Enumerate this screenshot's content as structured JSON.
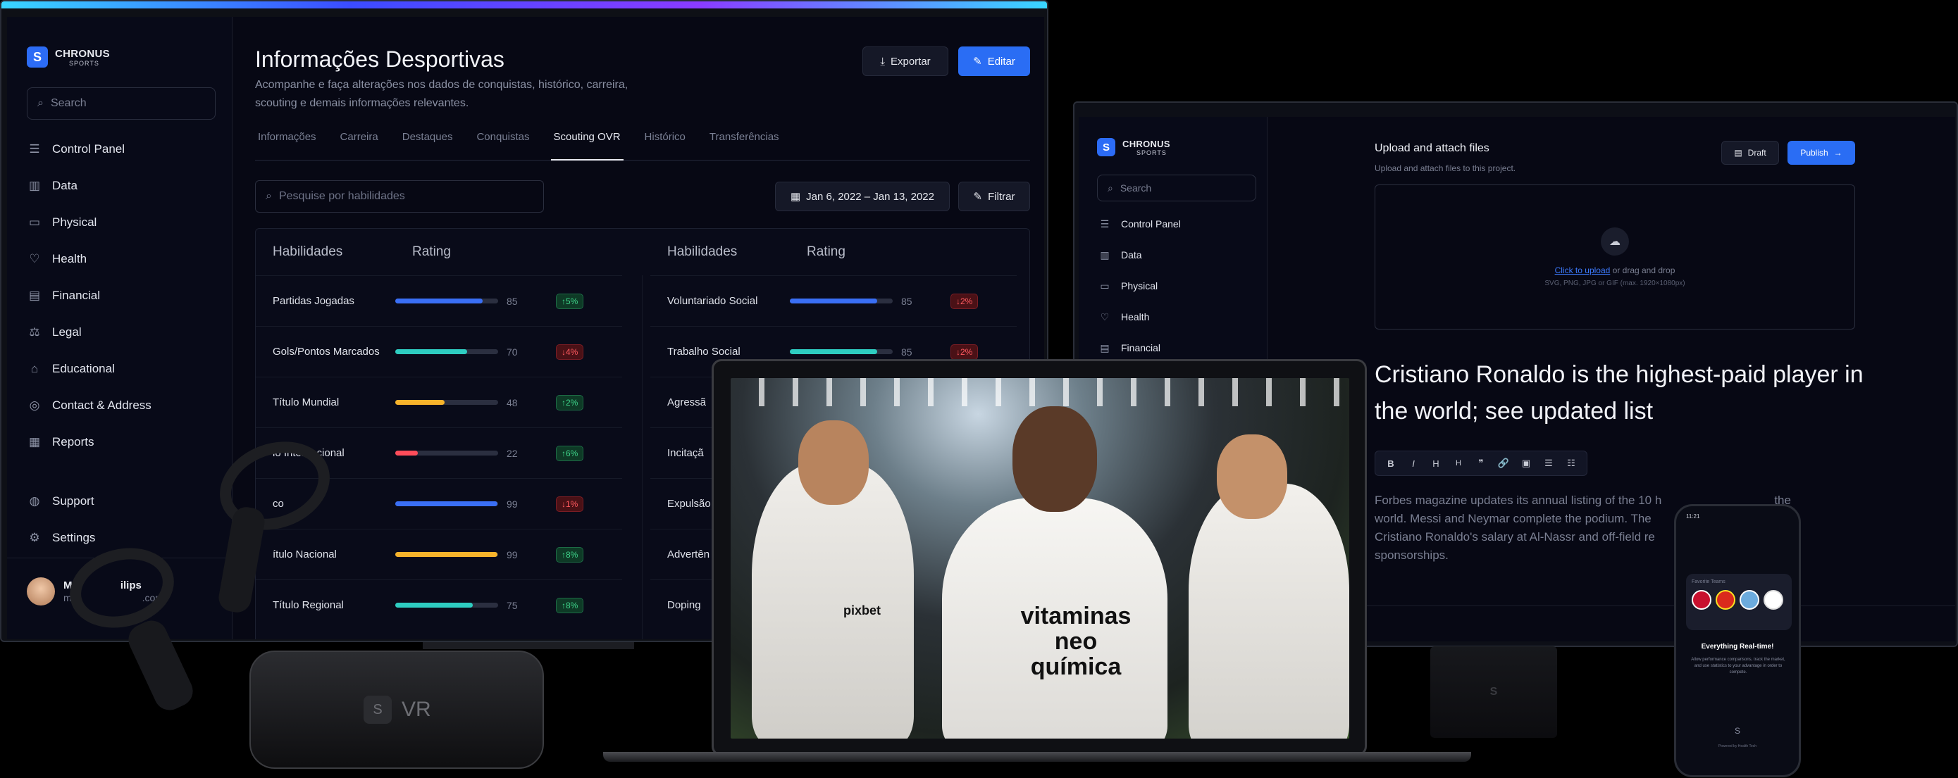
{
  "brand": {
    "name": "CHRONUS",
    "sub": "SPORTS"
  },
  "monitor1": {
    "search_placeholder": "Search",
    "nav": [
      {
        "label": "Control Panel",
        "icon": "sliders-icon"
      },
      {
        "label": "Data",
        "icon": "bar-chart-icon"
      },
      {
        "label": "Physical",
        "icon": "monitor-icon"
      },
      {
        "label": "Health",
        "icon": "health-icon"
      },
      {
        "label": "Financial",
        "icon": "wallet-icon"
      },
      {
        "label": "Legal",
        "icon": "scale-icon"
      },
      {
        "label": "Educational",
        "icon": "graduation-cap-icon"
      },
      {
        "label": "Contact & Address",
        "icon": "map-pin-icon"
      },
      {
        "label": "Reports",
        "icon": "report-icon"
      }
    ],
    "nav_bottom": [
      {
        "label": "Support",
        "icon": "support-icon"
      },
      {
        "label": "Settings",
        "icon": "gear-icon"
      }
    ],
    "user": {
      "name": "Ma",
      "name_tail": "ilips",
      "email": "m",
      "email_tail": ".com"
    },
    "title": "Informações Desportivas",
    "subtitle": "Acompanhe e faça alterações nos dados de conquistas, histórico, carreira, scouting e demais informações relevantes.",
    "export_label": "Exportar",
    "edit_label": "Editar",
    "tabs": [
      "Informações",
      "Carreira",
      "Destaques",
      "Conquistas",
      "Scouting OVR",
      "Histórico",
      "Transferências"
    ],
    "active_tab": "Scouting OVR",
    "skills_search_placeholder": "Pesquise por habilidades",
    "date_range": "Jan 6, 2022 – Jan 13, 2022",
    "filter_label": "Filtrar",
    "col_skill": "Habilidades",
    "col_rating": "Rating",
    "rows_left": [
      {
        "skill": "Partidas Jogadas",
        "value": 85,
        "color": "#3a6ff5",
        "change": "5%",
        "dir": "up"
      },
      {
        "skill": "Gols/Pontos Marcados",
        "value": 70,
        "color": "#2ecdc1",
        "change": "4%",
        "dir": "dn"
      },
      {
        "skill": "Título Mundial",
        "value": 48,
        "color": "#f7b32b",
        "change": "2%",
        "dir": "up"
      },
      {
        "skill": "lo Internacional",
        "value": 22,
        "color": "#ff4d5a",
        "change": "6%",
        "dir": "up"
      },
      {
        "skill": "co",
        "value": 99,
        "color": "#3a6ff5",
        "change": "1%",
        "dir": "dn"
      },
      {
        "skill": "ítulo Nacional",
        "value": 99,
        "color": "#f7b32b",
        "change": "8%",
        "dir": "up"
      },
      {
        "skill": "Título Regional",
        "value": 75,
        "color": "#2ecdc1",
        "change": "8%",
        "dir": "up"
      }
    ],
    "rows_right": [
      {
        "skill": "Voluntariado Social",
        "value": 85,
        "color": "#3a6ff5",
        "change": "2%",
        "dir": "dn"
      },
      {
        "skill": "Trabalho Social",
        "value": 85,
        "color": "#2ecdc1",
        "change": "2%",
        "dir": "dn"
      },
      {
        "skill": "Agressã"
      },
      {
        "skill": "Incitaçã"
      },
      {
        "skill": "Expulsão"
      },
      {
        "skill": "Advertên"
      },
      {
        "skill": "Doping"
      }
    ]
  },
  "monitor2": {
    "search_placeholder": "Search",
    "nav": [
      {
        "label": "Control Panel",
        "icon": "sliders-icon"
      },
      {
        "label": "Data",
        "icon": "bar-chart-icon"
      },
      {
        "label": "Physical",
        "icon": "monitor-icon"
      },
      {
        "label": "Health",
        "icon": "health-icon"
      },
      {
        "label": "Financial",
        "icon": "wallet-icon"
      }
    ],
    "upload_title": "Upload and attach files",
    "upload_sub": "Upload and attach files to this project.",
    "draft_label": "Draft",
    "publish_label": "Publish",
    "upload_link": "Click to upload",
    "upload_rest": "or drag and drop",
    "upload_hint": "SVG, PNG, JPG or GIF (max. 1920×1080px)",
    "headline": "Cristiano Ronaldo is the highest-paid player in the world; see updated list",
    "toolbar": [
      "B",
      "I",
      "H",
      "H",
      "❞",
      "🔗",
      "▣",
      "☰",
      "☷"
    ],
    "body": "Forbes magazine updates its annual listing of the 10 h",
    "body_tail": "the",
    "body2": "world. Messi and Neymar complete the podium. The",
    "body3": "Cristiano Ronaldo's salary at Al-Nassr and off-field re",
    "body4": "sponsorships."
  },
  "phone": {
    "time": "11:21",
    "title": "Everything Real-time!",
    "text": "Allow performance comparisons, track the market, and use statistics to your advantage in order to compete.",
    "section": "Favorite Teams",
    "footer": "Powered by Health Tech"
  },
  "vr": {
    "label": "VR"
  },
  "jersey": {
    "sponsor1": "vitaminas",
    "sponsor2": "neo",
    "sponsor3": "química",
    "sponsor_small": "pixbet"
  }
}
